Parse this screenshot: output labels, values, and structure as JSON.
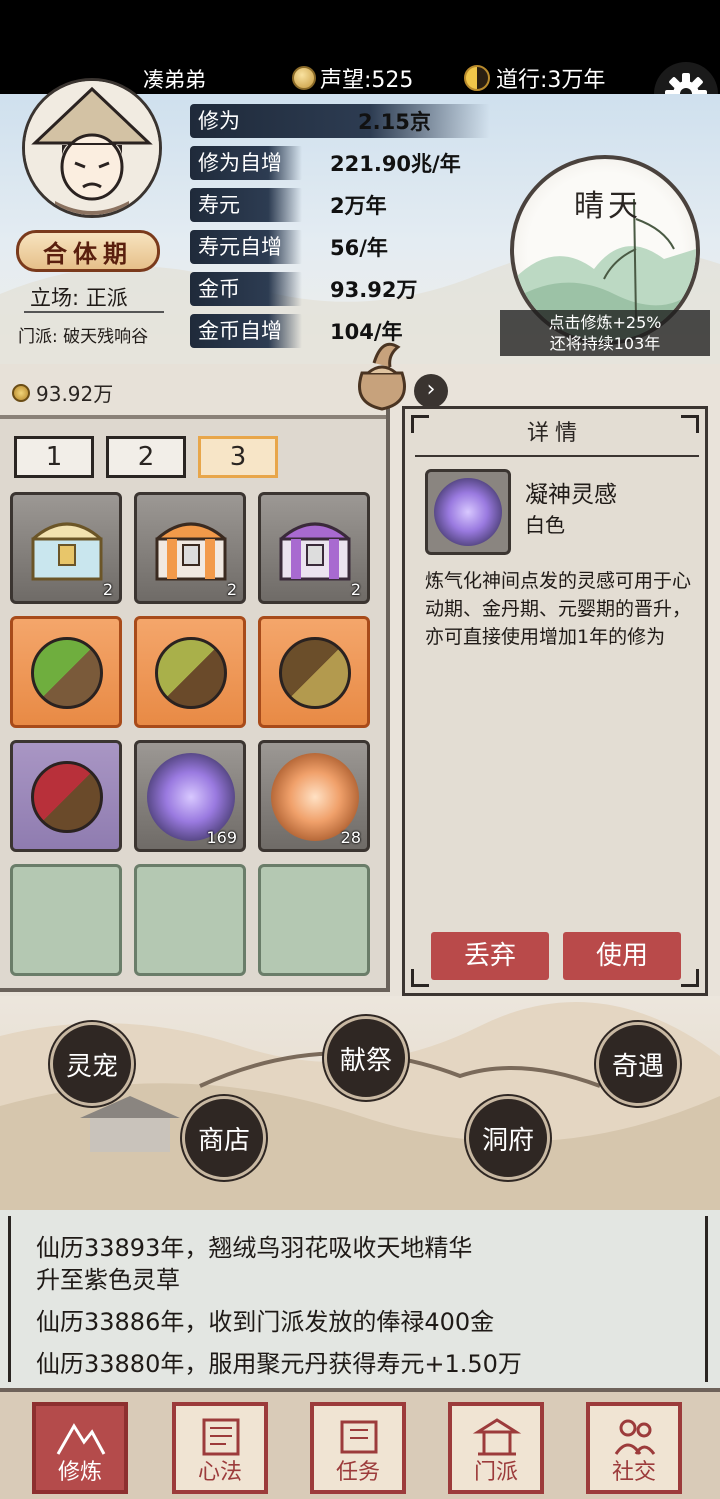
{
  "topbar": {
    "player_name": "凑弟弟",
    "fame": "声望:525",
    "dao": "道行:3万年"
  },
  "profile": {
    "rank": "合体期",
    "stance": "立场: 正派",
    "sect": "门派: 破天残响谷"
  },
  "stats": [
    {
      "label": "修为",
      "value": "2.15京"
    },
    {
      "label": "修为自增",
      "value": "221.90兆/年"
    },
    {
      "label": "寿元",
      "value": "2万年"
    },
    {
      "label": "寿元自增",
      "value": "56/年"
    },
    {
      "label": "金币",
      "value": "93.92万"
    },
    {
      "label": "金币自增",
      "value": "104/年"
    }
  ],
  "weather": {
    "title": "晴天",
    "tip_line1": "点击修炼+25%",
    "tip_line2": "还将持续103年"
  },
  "inventory": {
    "gold": "93.92万",
    "tabs": [
      "1",
      "2",
      "3"
    ],
    "active_tab": "3",
    "items": [
      {
        "kind": "chest-gold",
        "count": "2"
      },
      {
        "kind": "chest-orange",
        "count": "2"
      },
      {
        "kind": "chest-purple",
        "count": "2"
      },
      {
        "kind": "pill-green",
        "count": ""
      },
      {
        "kind": "pill-olive",
        "count": ""
      },
      {
        "kind": "pill-brown",
        "count": ""
      },
      {
        "kind": "pill-red",
        "count": ""
      },
      {
        "kind": "orb-purple",
        "count": "169"
      },
      {
        "kind": "orb-orange",
        "count": "28"
      }
    ]
  },
  "detail": {
    "header": "详情",
    "item_name": "凝神灵感",
    "item_grade": "白色",
    "description": "炼气化神间点发的灵感可用于心动期、金丹期、元婴期的晋升，亦可直接使用增加1年的修为",
    "discard": "丢弃",
    "use": "使用"
  },
  "actions": {
    "pet": "灵宠",
    "offering": "献祭",
    "adventure": "奇遇",
    "shop": "商店",
    "cave": "洞府"
  },
  "log": [
    "仙历33893年，翘绒鸟羽花吸收天地精华",
    "升至紫色灵草",
    "仙历33886年，收到门派发放的俸禄400金",
    "仙历33880年，服用聚元丹获得寿元+1.50万"
  ],
  "nav": {
    "cultivate": "修炼",
    "method": "心法",
    "task": "任务",
    "sect": "门派",
    "social": "社交"
  }
}
